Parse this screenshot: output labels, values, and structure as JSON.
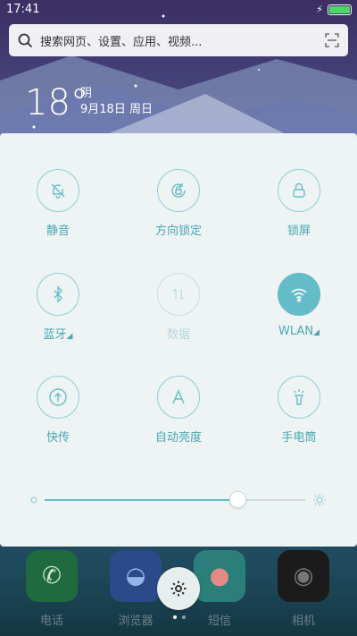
{
  "status_bar": {
    "time": "17:41",
    "battery_level": 1.0
  },
  "search": {
    "placeholder": "搜索网页、设置、应用、视频..."
  },
  "weather": {
    "temperature": "18°",
    "condition": "阴",
    "date": "9月18日 周日"
  },
  "toggles": [
    {
      "label": "静音",
      "icon": "bell-off-icon",
      "state": "off"
    },
    {
      "label": "方向锁定",
      "icon": "rotation-lock-icon",
      "state": "off"
    },
    {
      "label": "锁屏",
      "icon": "lock-icon",
      "state": "off"
    },
    {
      "label": "蓝牙",
      "icon": "bluetooth-icon",
      "state": "off",
      "has_menu": true
    },
    {
      "label": "数据",
      "icon": "data-arrows-icon",
      "state": "disabled"
    },
    {
      "label": "WLAN",
      "icon": "wifi-icon",
      "state": "on",
      "has_menu": true
    },
    {
      "label": "快传",
      "icon": "upload-icon",
      "state": "off"
    },
    {
      "label": "自动亮度",
      "icon": "auto-brightness-icon",
      "state": "off"
    },
    {
      "label": "手电筒",
      "icon": "flashlight-icon",
      "state": "off"
    }
  ],
  "brightness": {
    "level": 0.74
  },
  "dock": [
    {
      "label": "电话",
      "icon": "phone-icon"
    },
    {
      "label": "浏览器",
      "icon": "browser-icon"
    },
    {
      "label": "短信",
      "icon": "message-icon"
    },
    {
      "label": "相机",
      "icon": "camera-icon"
    }
  ],
  "colors": {
    "accent": "#63bcc7",
    "panel": "#eef3f3"
  }
}
